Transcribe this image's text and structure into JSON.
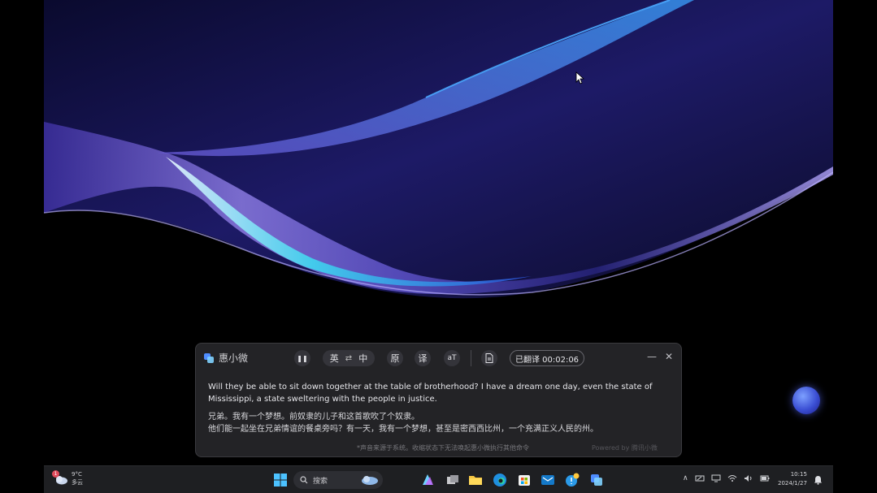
{
  "caption_app": {
    "title": "惠小微",
    "pause_label": "❚❚",
    "lang_from": "英",
    "lang_sep": "⇄",
    "lang_to": "中",
    "mode_original": "原",
    "mode_translation": "译",
    "font_size_label": "aT",
    "status_text": "已翻译 00:02:06",
    "minimize_label": "—",
    "close_label": "✕",
    "transcript_en": "Will they be able to sit down together at the table of brotherhood? I have a dream one day, even the state of Mississippi, a state sweltering with the people in justice.",
    "transcript_zh_1": "兄弟。我有一个梦想。前奴隶的儿子和这首歌吹了个奴隶。",
    "transcript_zh_2": "他们能一起坐在兄弟情谊的餐桌旁吗？有一天，我有一个梦想，甚至是密西西比州，一个充满正义人民的州。",
    "footer_note": "*声音来源于系统。收缩状态下无法唤起惠小微执行其他命令",
    "powered_by": "Powered by 腾讯小微"
  },
  "taskbar": {
    "weather_temp": "9°C",
    "weather_desc": "多云",
    "weather_badge": "1",
    "search_placeholder": "搜索",
    "time": "10:15",
    "date": "2024/1/27",
    "tray_chevron": "∧"
  },
  "colors": {
    "accent": "#4f8dff",
    "window_bg": "#232326",
    "taskbar_bg": "#1e1f22"
  }
}
